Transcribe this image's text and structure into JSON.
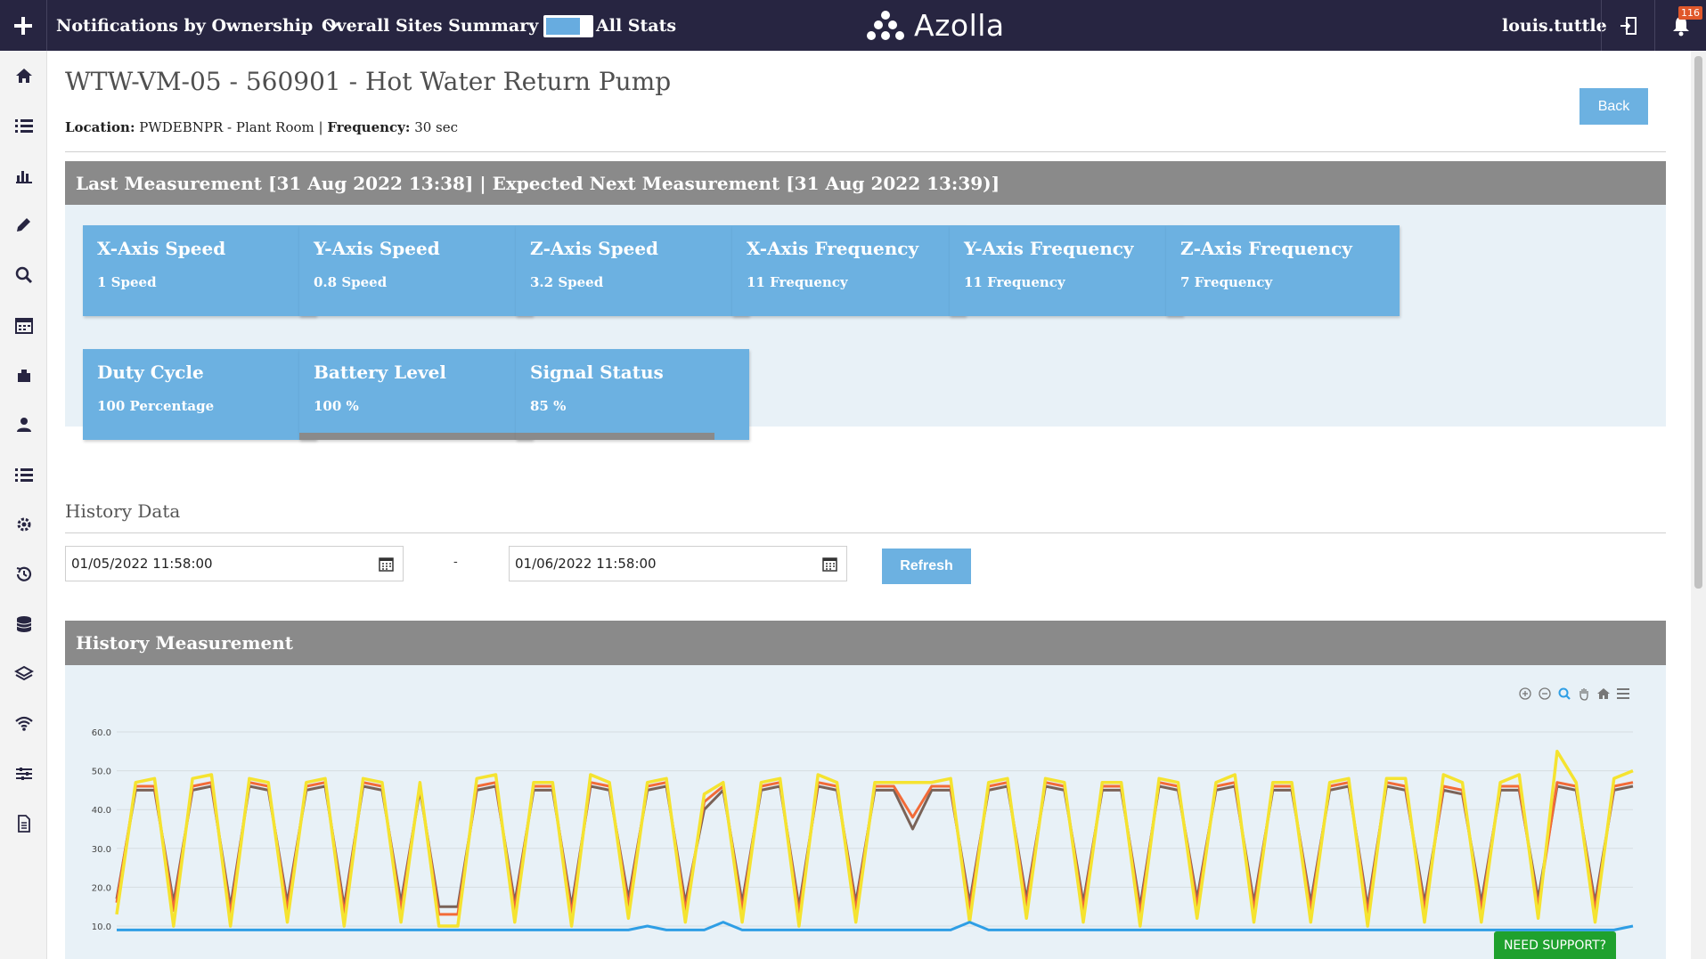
{
  "topbar": {
    "menu1": "Notifications by Ownership",
    "menu2": "Overall Sites Summary",
    "toggle_label": "All Stats",
    "logo_text": "Azolla",
    "user": "louis.tuttle",
    "notification_count": "116"
  },
  "page": {
    "title": "WTW-VM-05 - 560901 - Hot Water Return Pump",
    "location_label": "Location:",
    "location_value": "PWDEBNPR - Plant Room",
    "frequency_label": "Frequency:",
    "frequency_value": "30 sec",
    "back_label": "Back"
  },
  "last_measurement": {
    "header": "Last Measurement [31 Aug 2022 13:38] | Expected Next Measurement [31 Aug 2022 13:39)]",
    "tiles": [
      {
        "title": "X-Axis Speed",
        "value": "1 Speed"
      },
      {
        "title": "Y-Axis Speed",
        "value": "0.8 Speed"
      },
      {
        "title": "Z-Axis Speed",
        "value": "3.2 Speed"
      },
      {
        "title": "X-Axis Frequency",
        "value": "11 Frequency"
      },
      {
        "title": "Y-Axis Frequency",
        "value": "11 Frequency"
      },
      {
        "title": "Z-Axis Frequency",
        "value": "7 Frequency"
      },
      {
        "title": "Duty Cycle",
        "value": "100 Percentage"
      },
      {
        "title": "Battery Level",
        "value": "100 %",
        "level": 1.0
      },
      {
        "title": "Signal Status",
        "value": "85 %",
        "level": 0.85
      }
    ]
  },
  "history": {
    "title": "History Data",
    "start_date": "01/05/2022 11:58:00",
    "separator": "-",
    "end_date": "01/06/2022 11:58:00",
    "refresh_label": "Refresh",
    "chart_header": "History Measurement"
  },
  "support_label": "NEED SUPPORT?",
  "colors": {
    "topbar": "#272541",
    "tile": "#6cb1e1",
    "header_bar": "#8a8a8a",
    "panel_bg": "#e8f1f7",
    "series_brown": "#7a6358",
    "series_orange": "#f26b38",
    "series_yellow": "#f5e330",
    "series_blue": "#2e9ee5",
    "support": "#1fa12e"
  },
  "chart_data": {
    "type": "line",
    "yticks": [
      "60.0",
      "50.0",
      "40.0",
      "30.0",
      "20.0",
      "10.0"
    ],
    "ylim": [
      10,
      60
    ],
    "grid": true,
    "series": [
      {
        "values": [
          17,
          45,
          45,
          16,
          45,
          46,
          15,
          46,
          45,
          16,
          45,
          46,
          15,
          46,
          45,
          16,
          45,
          15,
          15,
          45,
          46,
          16,
          45,
          45,
          15,
          46,
          45,
          17,
          45,
          46,
          16,
          40,
          45,
          16,
          45,
          46,
          15,
          46,
          45,
          16,
          45,
          45,
          35,
          45,
          45,
          16,
          45,
          46,
          17,
          46,
          45,
          16,
          45,
          45,
          15,
          46,
          45,
          17,
          45,
          46,
          16,
          45,
          45,
          16,
          45,
          46,
          15,
          46,
          45,
          16,
          45,
          44,
          16,
          45,
          45,
          17,
          46,
          45,
          16,
          45,
          46
        ]
      },
      {
        "values": [
          16,
          46,
          46,
          14,
          46,
          47,
          13,
          47,
          46,
          14,
          46,
          47,
          13,
          47,
          46,
          14,
          46,
          13,
          13,
          46,
          47,
          14,
          46,
          46,
          13,
          47,
          46,
          15,
          46,
          47,
          14,
          42,
          46,
          14,
          46,
          47,
          13,
          47,
          46,
          14,
          46,
          46,
          38,
          46,
          46,
          14,
          46,
          47,
          15,
          47,
          46,
          14,
          46,
          46,
          13,
          47,
          46,
          15,
          46,
          47,
          14,
          46,
          46,
          14,
          46,
          47,
          13,
          47,
          46,
          14,
          46,
          45,
          14,
          46,
          46,
          15,
          47,
          46,
          14,
          46,
          47
        ]
      },
      {
        "values": [
          13,
          47,
          48,
          10,
          48,
          49,
          10,
          48,
          47,
          11,
          47,
          48,
          10,
          48,
          47,
          11,
          47,
          10,
          10,
          48,
          49,
          11,
          47,
          47,
          10,
          49,
          47,
          12,
          47,
          48,
          11,
          44,
          47,
          11,
          47,
          48,
          10,
          49,
          47,
          11,
          47,
          47,
          47,
          47,
          48,
          11,
          47,
          48,
          12,
          48,
          47,
          11,
          47,
          47,
          10,
          48,
          47,
          12,
          47,
          49,
          11,
          47,
          47,
          11,
          47,
          48,
          10,
          48,
          48,
          11,
          49,
          47,
          11,
          47,
          49,
          12,
          55,
          47,
          11,
          48,
          50
        ]
      },
      {
        "values": [
          9,
          9,
          9,
          9,
          9,
          9,
          9,
          9,
          9,
          9,
          9,
          9,
          9,
          9,
          9,
          9,
          9,
          9,
          9,
          9,
          9,
          9,
          9,
          9,
          9,
          9,
          9,
          9,
          10,
          9,
          9,
          9,
          11,
          9,
          9,
          9,
          9,
          9,
          9,
          9,
          9,
          9,
          9,
          9,
          9,
          11,
          9,
          9,
          9,
          9,
          9,
          9,
          9,
          9,
          9,
          9,
          9,
          9,
          9,
          9,
          9,
          9,
          9,
          9,
          9,
          9,
          9,
          9,
          9,
          9,
          9,
          9,
          9,
          9,
          9,
          9,
          9,
          9,
          9,
          9,
          10
        ]
      }
    ]
  }
}
